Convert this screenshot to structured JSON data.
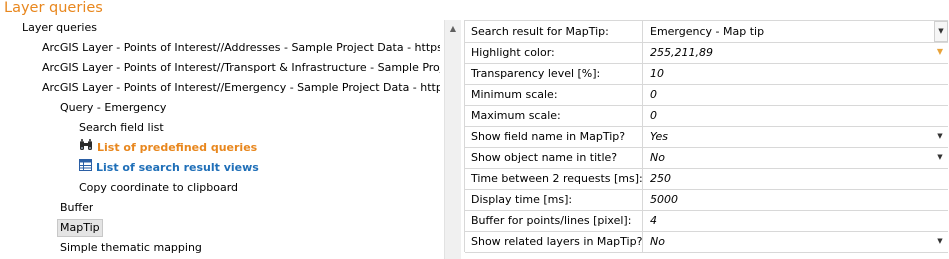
{
  "header": {
    "title": "Layer queries"
  },
  "tree": {
    "root": "Layer queries",
    "layers": [
      "ArcGIS Layer - Points of Interest//Addresses - Sample Project Data - https://w-w",
      "ArcGIS Layer - Points of Interest//Transport & Infrastructure - Sample Project Da",
      "ArcGIS Layer - Points of Interest//Emergency - Sample Project Data - https://w-"
    ],
    "query": "Query - Emergency",
    "search_field_list": "Search field list",
    "predefined_queries": "List of predefined queries",
    "search_result_views": "List of search result views",
    "copy_coordinate": "Copy coordinate to clipboard",
    "buffer": "Buffer",
    "maptip": "MapTip",
    "thematic": "Simple thematic mapping"
  },
  "properties": [
    {
      "label": "Search result for MapTip:",
      "value": "Emergency - Map tip"
    },
    {
      "label": "Highlight color:",
      "value": "255,211,89"
    },
    {
      "label": "Transparency level [%]:",
      "value": "10"
    },
    {
      "label": "Minimum scale:",
      "value": "0"
    },
    {
      "label": "Maximum scale:",
      "value": "0"
    },
    {
      "label": "Show field name in MapTip?",
      "value": "Yes"
    },
    {
      "label": "Show object name in title?",
      "value": "No"
    },
    {
      "label": "Time between 2 requests [ms]:",
      "value": "250"
    },
    {
      "label": "Display time [ms]:",
      "value": "5000"
    },
    {
      "label": "Buffer for points/lines [pixel]:",
      "value": "4"
    },
    {
      "label": "Show related layers in MapTip?",
      "value": "No"
    }
  ],
  "colors": {
    "accent": "#e8871e",
    "link_blue": "#1f6fb8",
    "highlight": "#ffd359"
  }
}
